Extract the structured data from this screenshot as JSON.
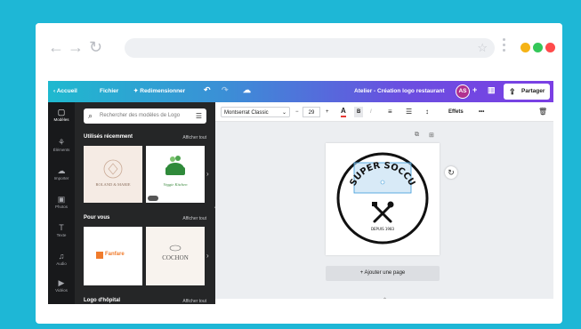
{
  "browser": {
    "nav": {
      "back": "←",
      "forward": "→",
      "reload": "↻"
    },
    "star": "☆",
    "traffic_colors": [
      "#f5b316",
      "#34c759",
      "#ff4b4b"
    ]
  },
  "topbar": {
    "home": "‹  Accueil",
    "file": "Fichier",
    "resize": "✦ Redimensionner",
    "undo": "↶",
    "redo": "↷",
    "cloud": "☁",
    "doc_title": "Atelier - Création logo restaurant",
    "avatar": "AS",
    "plus": "+",
    "analytics": "▥",
    "share": "Partager"
  },
  "rail": [
    {
      "glyph": "▢",
      "label": "Modèles",
      "active": true
    },
    {
      "glyph": "⚘",
      "label": "Éléments",
      "active": false
    },
    {
      "glyph": "☁",
      "label": "Importer",
      "active": false
    },
    {
      "glyph": "▣",
      "label": "Photos",
      "active": false
    },
    {
      "glyph": "T",
      "label": "Texte",
      "active": false
    },
    {
      "glyph": "♫",
      "label": "Audio",
      "active": false
    },
    {
      "glyph": "▶",
      "label": "Vidéos",
      "active": false
    }
  ],
  "panel": {
    "search_placeholder": "Rechercher des modèles de Logo",
    "sections": [
      {
        "title": "Utilisés récemment",
        "link": "Afficher tout"
      },
      {
        "title": "Pour vous",
        "link": "Afficher tout"
      },
      {
        "title": "Logo d'hôpital",
        "link": "Afficher tout"
      }
    ],
    "thumbs": {
      "t1": "ROLAND & MARIE",
      "t2": "Veggie Kitchen",
      "t3": "Fanfare",
      "t4": "COCHON"
    }
  },
  "toolbar": {
    "font": "Montserrat Classic",
    "minus": "−",
    "size": "29",
    "plus": "+",
    "color_letter": "A",
    "bold": "B",
    "italic": "I",
    "align": "≡",
    "list": "☰",
    "spacing": "↕",
    "effects": "Effets",
    "more": "•••",
    "trash": "🗑"
  },
  "canvas": {
    "logo_title": "SUPER SOCCU",
    "logo_sub": "DEPUIS 1983",
    "add_page": "+ Ajouter une page",
    "rotate": "↻"
  }
}
